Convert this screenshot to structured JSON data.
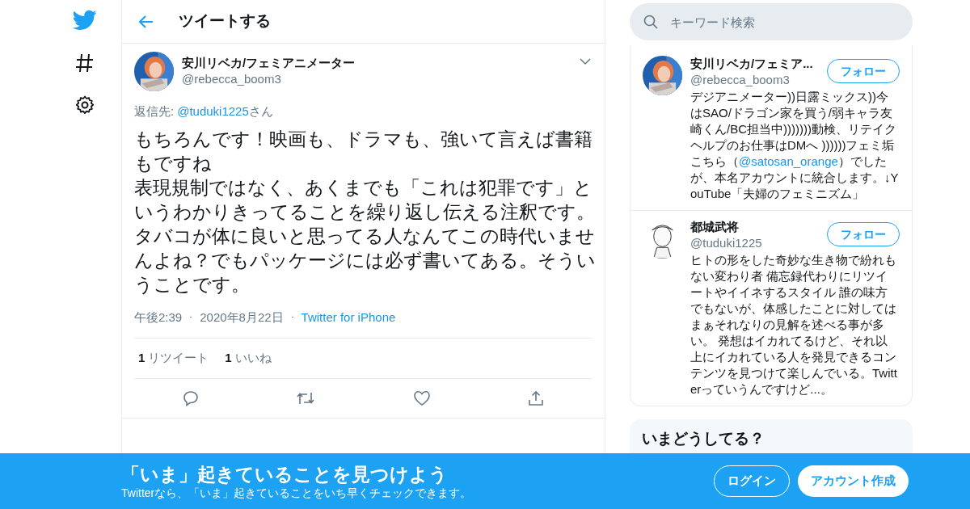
{
  "header": {
    "title": "ツイートする"
  },
  "tweet": {
    "name": "安川リベカ/フェミアニメーター",
    "handle": "@rebecca_boom3",
    "reply_label": "返信先:",
    "reply_to": "@tuduki1225",
    "reply_suffix": "さん",
    "body": [
      "もちろんです！映画も、ドラマも、強いて言えば書籍もですね",
      "表現規制ではなく、あくまでも「これは犯罪です」というわかりきってることを繰り返し伝える注釈です。",
      "タバコが体に良いと思ってる人なんてこの時代いませんよね？でもパッケージには必ず書いてある。そういうことです。"
    ],
    "time": "午後2:39",
    "separator": "・",
    "date": "2020年8月22日",
    "source": "Twitter for iPhone",
    "stats": [
      {
        "count": "1",
        "label": "リツイート"
      },
      {
        "count": "1",
        "label": "いいね"
      }
    ]
  },
  "search": {
    "placeholder": "キーワード検索"
  },
  "users": [
    {
      "name": "安川リベカ/フェミア...",
      "handle": "@rebecca_boom3",
      "follow": "フォロー",
      "bio": [
        {
          "kind": "text",
          "text": "デジアニメーター))日露ミックス))今はSAO/ドラゴン家を買う/弱キャラ友崎くん/BC担当中)))))))動検、リテイクヘルプのお仕事はDMへ ))))))フェミ垢こちら（"
        },
        {
          "kind": "mention",
          "text": "@satosan_orange"
        },
        {
          "kind": "text",
          "text": "）でしたが、本名アカウントに統合します。↓YouTube「夫婦のフェミニズム」"
        }
      ]
    },
    {
      "name": "都城武将",
      "handle": "@tuduki1225",
      "follow": "フォロー",
      "bio": [
        {
          "kind": "text",
          "text": "ヒトの形をした奇妙な生き物で紛れもない変わり者 備忘録代わりにリツイートやイイネするスタイル 誰の味方でもないが、体感したことに対してはまぁそれなりの見解を述べる事が多い。 発想はイカれてるけど、それ以上にイカれている人を発見できるコンテンツを見つけて楽しんでいる。Twitterっていうんですけど...。"
        }
      ]
    }
  ],
  "trends": {
    "title": "いまどうしてる？"
  },
  "banner": {
    "title": "「いま」起きていることを見つけよう",
    "subtitle": "Twitterなら、「いま」起きていることをいち早くチェックできます。",
    "login": "ログイン",
    "signup": "アカウント作成"
  }
}
